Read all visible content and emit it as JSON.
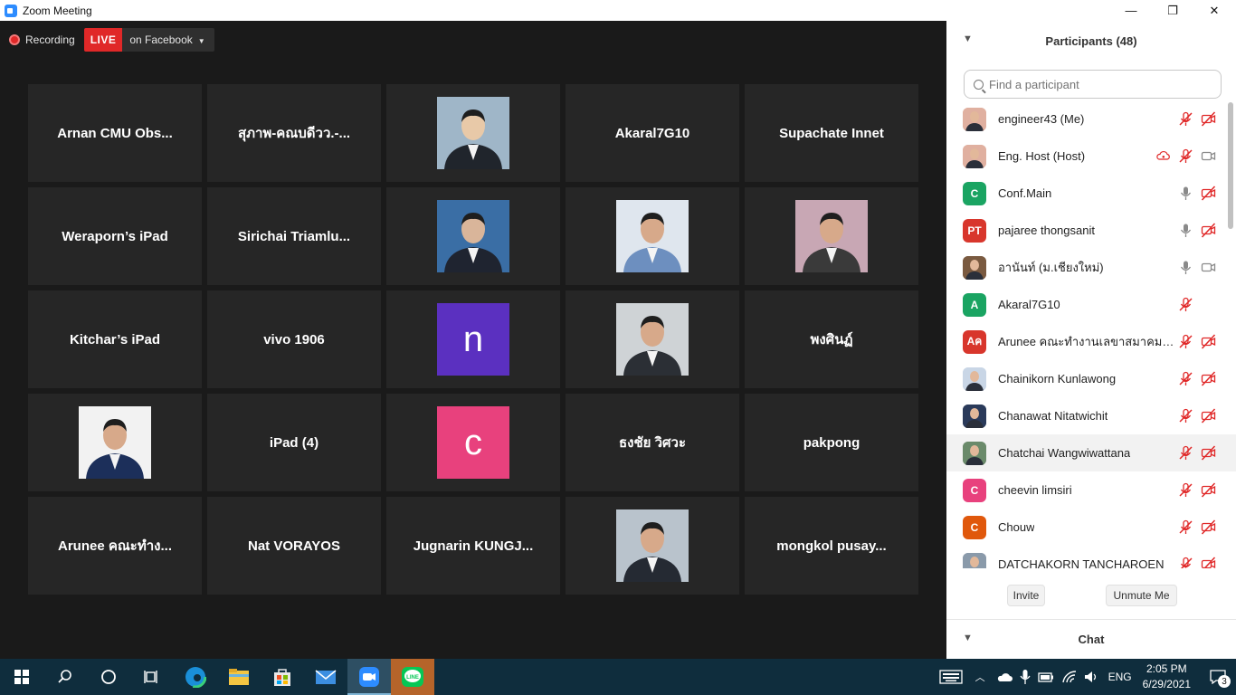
{
  "window": {
    "title": "Zoom Meeting",
    "minimize": "—",
    "restore": "❐",
    "close": "✕"
  },
  "toolbar": {
    "recording": "Recording",
    "live": "LIVE",
    "live_target": "on Facebook"
  },
  "tiles": [
    {
      "type": "name",
      "text": "Arnan  CMU  Obs..."
    },
    {
      "type": "name",
      "text": "สุภาพ-คณบดีวว.-..."
    },
    {
      "type": "photo",
      "colors": [
        "#9fb6c8",
        "#20252c",
        "#e8c9a8"
      ]
    },
    {
      "type": "name",
      "text": "Akaral7G10"
    },
    {
      "type": "name",
      "text": "Supachate Innet"
    },
    {
      "type": "name",
      "text": "Weraporn’s iPad"
    },
    {
      "type": "name",
      "text": "Sirichai  Triamlu..."
    },
    {
      "type": "photo",
      "colors": [
        "#3a6ea5",
        "#1f2430",
        "#d9b59a"
      ]
    },
    {
      "type": "photo",
      "colors": [
        "#dfe6ee",
        "#6d8fbf",
        "#d7a98a"
      ]
    },
    {
      "type": "photo",
      "colors": [
        "#c8a7b4",
        "#3a3a3a",
        "#d7a98a"
      ]
    },
    {
      "type": "name",
      "text": "Kitchar’s iPad"
    },
    {
      "type": "name",
      "text": "vivo 1906"
    },
    {
      "type": "letter",
      "text": "n",
      "color": "#5b30c0"
    },
    {
      "type": "photo",
      "colors": [
        "#cfd3d6",
        "#2b2f35",
        "#d7a98a"
      ]
    },
    {
      "type": "name",
      "text": "พงศินฏ์"
    },
    {
      "type": "photo",
      "colors": [
        "#f2f2f2",
        "#1c2f5a",
        "#d7a98a"
      ]
    },
    {
      "type": "name",
      "text": "iPad (4)"
    },
    {
      "type": "letter",
      "text": "c",
      "color": "#e8417d"
    },
    {
      "type": "name",
      "text": "ธงชัย  วิศวะ"
    },
    {
      "type": "name",
      "text": "pakpong"
    },
    {
      "type": "name",
      "text": "Arunee  คณะทำง..."
    },
    {
      "type": "name",
      "text": "Nat VORAYOS"
    },
    {
      "type": "name",
      "text": "Jugnarin  KUNGJ..."
    },
    {
      "type": "photo",
      "colors": [
        "#b9c3cc",
        "#252a33",
        "#d7a98a"
      ]
    },
    {
      "type": "name",
      "text": "mongkol  pusay..."
    }
  ],
  "participants_panel": {
    "title": "Participants (48)",
    "search_placeholder": "Find a participant",
    "items": [
      {
        "name": "engineer43 (Me)",
        "avatar": "pic",
        "color": "#e0b0a0",
        "cloud": false,
        "mic": "muted",
        "video": "off"
      },
      {
        "name": "Eng. Host (Host)",
        "avatar": "pic",
        "color": "#e0b0a0",
        "cloud": true,
        "mic": "muted",
        "video": "on"
      },
      {
        "name": "Conf.Main",
        "avatar": "C",
        "color": "#1aa462",
        "cloud": false,
        "mic": "on",
        "video": "off"
      },
      {
        "name": "pajaree thongsanit",
        "avatar": "PT",
        "color": "#d8362c",
        "cloud": false,
        "mic": "on",
        "video": "off"
      },
      {
        "name": "อานันท์ (ม.เชียงใหม่)",
        "avatar": "pic",
        "color": "#7a5a40",
        "cloud": false,
        "mic": "on",
        "video": "on"
      },
      {
        "name": "Akaral7G10",
        "avatar": "A",
        "color": "#1aa462",
        "cloud": false,
        "mic": "muted",
        "video": "none"
      },
      {
        "name": "Arunee คณะทำงานเลขาสมาคมคณบ...",
        "avatar": "Aค",
        "color": "#d8362c",
        "cloud": false,
        "mic": "muted",
        "video": "off"
      },
      {
        "name": "Chainikorn Kunlawong",
        "avatar": "pic",
        "color": "#c9d6e6",
        "cloud": false,
        "mic": "muted",
        "video": "off"
      },
      {
        "name": "Chanawat Nitatwichit",
        "avatar": "pic",
        "color": "#2a3a5a",
        "cloud": false,
        "mic": "muted",
        "video": "off"
      },
      {
        "name": "Chatchai Wangwiwattana",
        "avatar": "pic",
        "color": "#6a8a6a",
        "cloud": false,
        "mic": "muted",
        "video": "off",
        "highlight": true
      },
      {
        "name": "cheevin limsiri",
        "avatar": "C",
        "color": "#e8417d",
        "cloud": false,
        "mic": "muted",
        "video": "off"
      },
      {
        "name": "Chouw",
        "avatar": "C",
        "color": "#e0580c",
        "cloud": false,
        "mic": "muted",
        "video": "off"
      },
      {
        "name": "DATCHAKORN TANCHAROEN",
        "avatar": "pic",
        "color": "#8a9aaa",
        "cloud": false,
        "mic": "muted",
        "video": "off"
      }
    ],
    "invite": "Invite",
    "unmute": "Unmute Me",
    "chat": "Chat"
  },
  "taskbar": {
    "lang": "ENG",
    "time": "2:05 PM",
    "date": "6/29/2021",
    "notifications": "3"
  }
}
